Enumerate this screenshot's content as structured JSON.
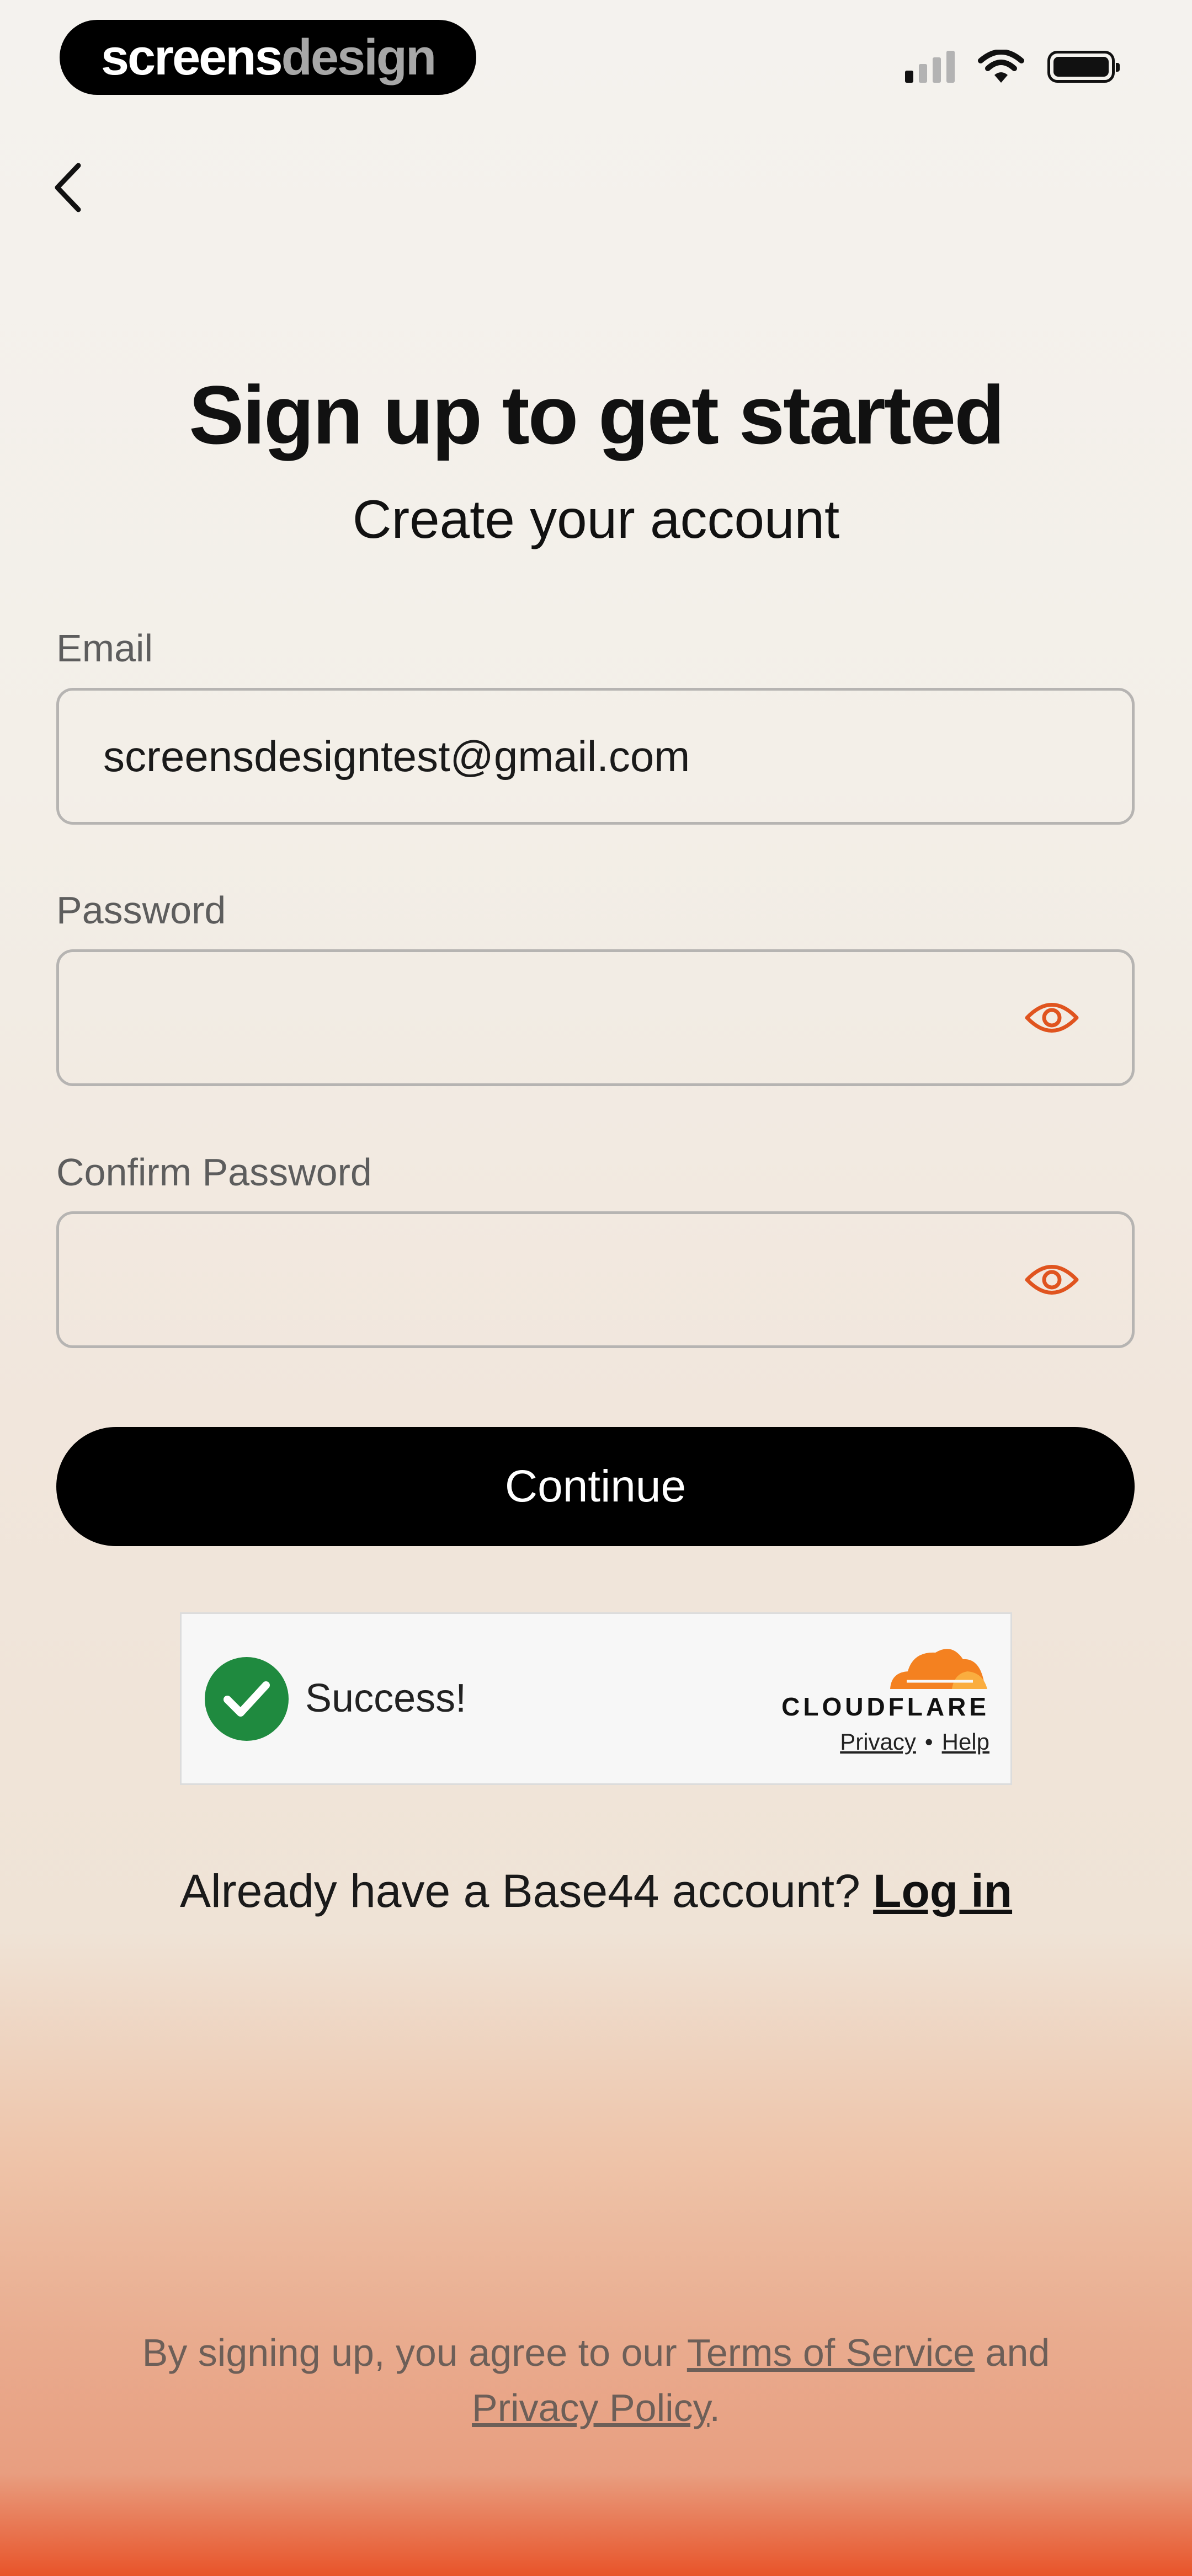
{
  "status_bar": {
    "brand_part1": "screens",
    "brand_part2": "design",
    "icons": [
      "signal-icon",
      "wifi-icon",
      "battery-icon"
    ]
  },
  "nav": {
    "back_icon": "chevron-left-icon"
  },
  "header": {
    "title": "Sign up to get started",
    "subtitle": "Create your account"
  },
  "form": {
    "email_label": "Email",
    "email_value": "screensdesigntest@gmail.com",
    "password_label": "Password",
    "password_value": "",
    "confirm_label": "Confirm Password",
    "confirm_value": "",
    "eye_icon": "eye-icon",
    "continue_label": "Continue"
  },
  "captcha": {
    "status": "Success!",
    "provider": "CLOUDFLARE",
    "privacy": "Privacy",
    "separator": "•",
    "help": "Help"
  },
  "login": {
    "prompt": "Already have a Base44 account?",
    "link": "Log in"
  },
  "legal": {
    "prefix": "By signing up, you agree to our",
    "terms": "Terms of Service",
    "and": "and",
    "privacy": "Privacy Policy",
    "suffix": "."
  },
  "colors": {
    "accent": "#e0541f",
    "success": "#1f8a3f",
    "button_bg": "#000000"
  }
}
